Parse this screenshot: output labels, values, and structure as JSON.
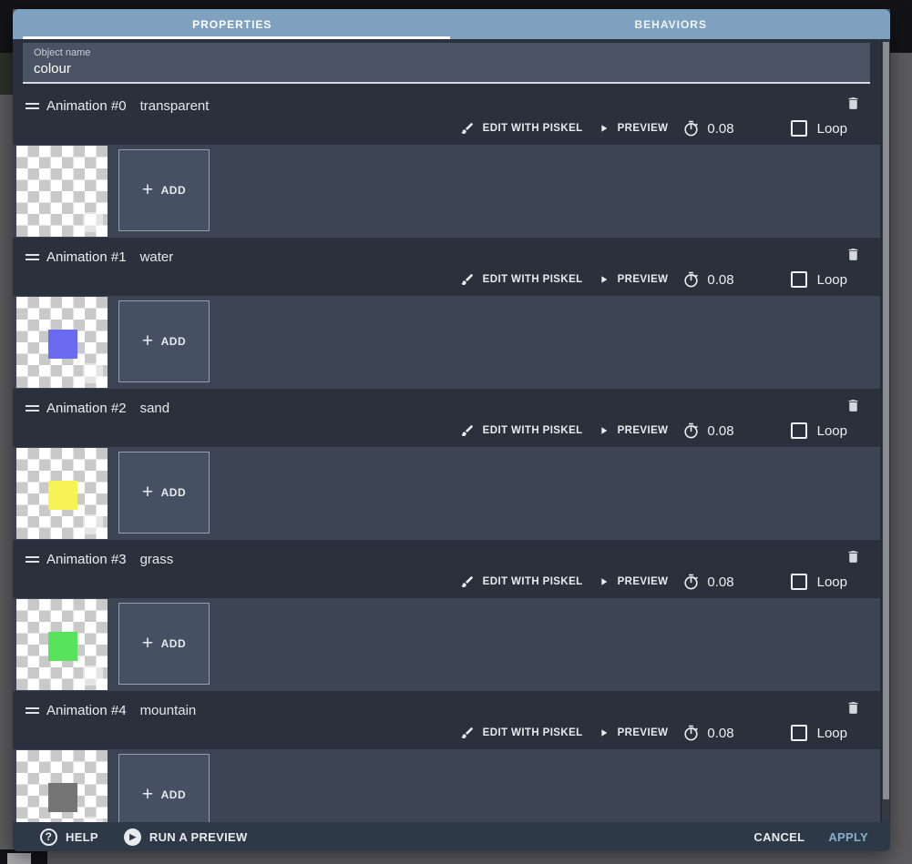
{
  "dialog": {
    "tabs": [
      {
        "label": "PROPERTIES",
        "active": true
      },
      {
        "label": "BEHAVIORS",
        "active": false
      }
    ],
    "object_name": {
      "label": "Object name",
      "value": "colour"
    }
  },
  "controls": {
    "edit": "EDIT WITH PISKEL",
    "preview": "PREVIEW",
    "loop": "Loop",
    "add": "ADD"
  },
  "animations": [
    {
      "title": "Animation #0",
      "name": "transparent",
      "time": "0.08",
      "loop_checked": false,
      "square_color": null
    },
    {
      "title": "Animation #1",
      "name": "water",
      "time": "0.08",
      "loop_checked": false,
      "square_color": "#6a6af0"
    },
    {
      "title": "Animation #2",
      "name": "sand",
      "time": "0.08",
      "loop_checked": false,
      "square_color": "#f7f357"
    },
    {
      "title": "Animation #3",
      "name": "grass",
      "time": "0.08",
      "loop_checked": false,
      "square_color": "#57e35c"
    },
    {
      "title": "Animation #4",
      "name": "mountain",
      "time": "0.08",
      "loop_checked": false,
      "square_color": "#747474"
    }
  ],
  "footer": {
    "help": "HELP",
    "run_preview": "RUN A PREVIEW",
    "cancel": "CANCEL",
    "apply": "APPLY"
  },
  "icons": {
    "drag": "drag-handle-icon",
    "delete": "trash-icon",
    "edit": "brush-icon",
    "preview": "play-icon",
    "time": "stopwatch-icon",
    "help": "help-circle-icon",
    "run": "play-circle-icon"
  },
  "colors": {
    "tab_bar": "#7fa1c0",
    "header_bg": "#2a313d",
    "strip_bg": "#3d4555",
    "field_bg": "#4a5363",
    "footer_bg": "#2e3947",
    "apply_text": "#85aecd",
    "checker_dark": "#c9c9c9",
    "checker_light": "#ffffff"
  }
}
